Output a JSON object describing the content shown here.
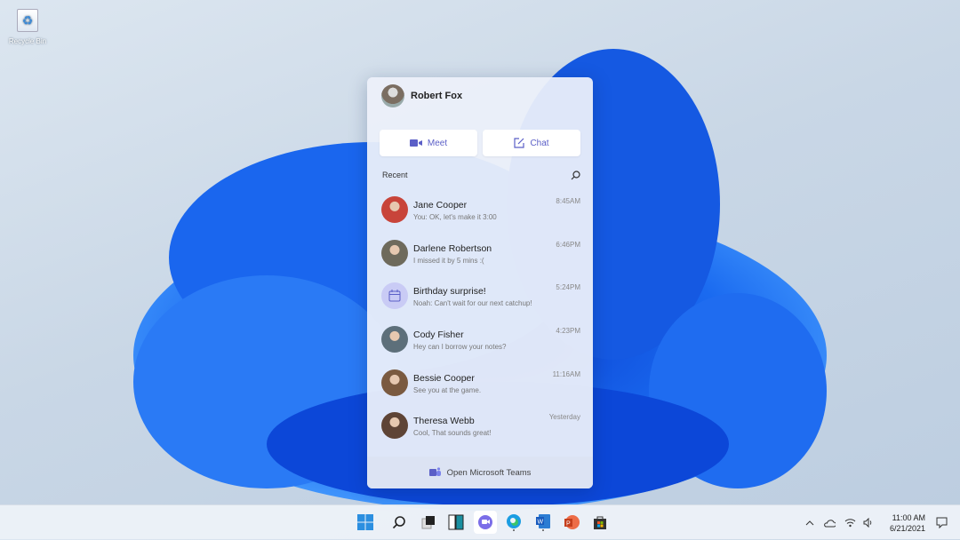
{
  "desktop": {
    "recycle_bin_label": "Recycle Bin"
  },
  "panel": {
    "user_name": "Robert Fox",
    "meet_label": "Meet",
    "chat_label": "Chat",
    "recent_label": "Recent",
    "conversations": [
      {
        "name": "Jane Cooper",
        "message": "You: OK, let's make it 3:00",
        "time": "8:45AM",
        "avatar": "#c8443a"
      },
      {
        "name": "Darlene Robertson",
        "message": "I missed it by 5 mins :(",
        "time": "6:46PM",
        "avatar": "#6e6a5c"
      },
      {
        "name": "Birthday surprise!",
        "message": "Noah: Can't wait for our next catchup!",
        "time": "5:24PM",
        "avatar": "#c9cbf5"
      },
      {
        "name": "Cody Fisher",
        "message": "Hey can I borrow your notes?",
        "time": "4:23PM",
        "avatar": "#5d6f7a"
      },
      {
        "name": "Bessie Cooper",
        "message": "See you at the game.",
        "time": "11:16AM",
        "avatar": "#7a5a40"
      },
      {
        "name": "Theresa Webb",
        "message": "Cool, That sounds great!",
        "time": "Yesterday",
        "avatar": "#5e4436"
      }
    ],
    "footer_label": "Open Microsoft Teams"
  },
  "taskbar": {
    "time": "11:00 AM",
    "date": "6/21/2021",
    "accent": "#5b5fc7"
  }
}
